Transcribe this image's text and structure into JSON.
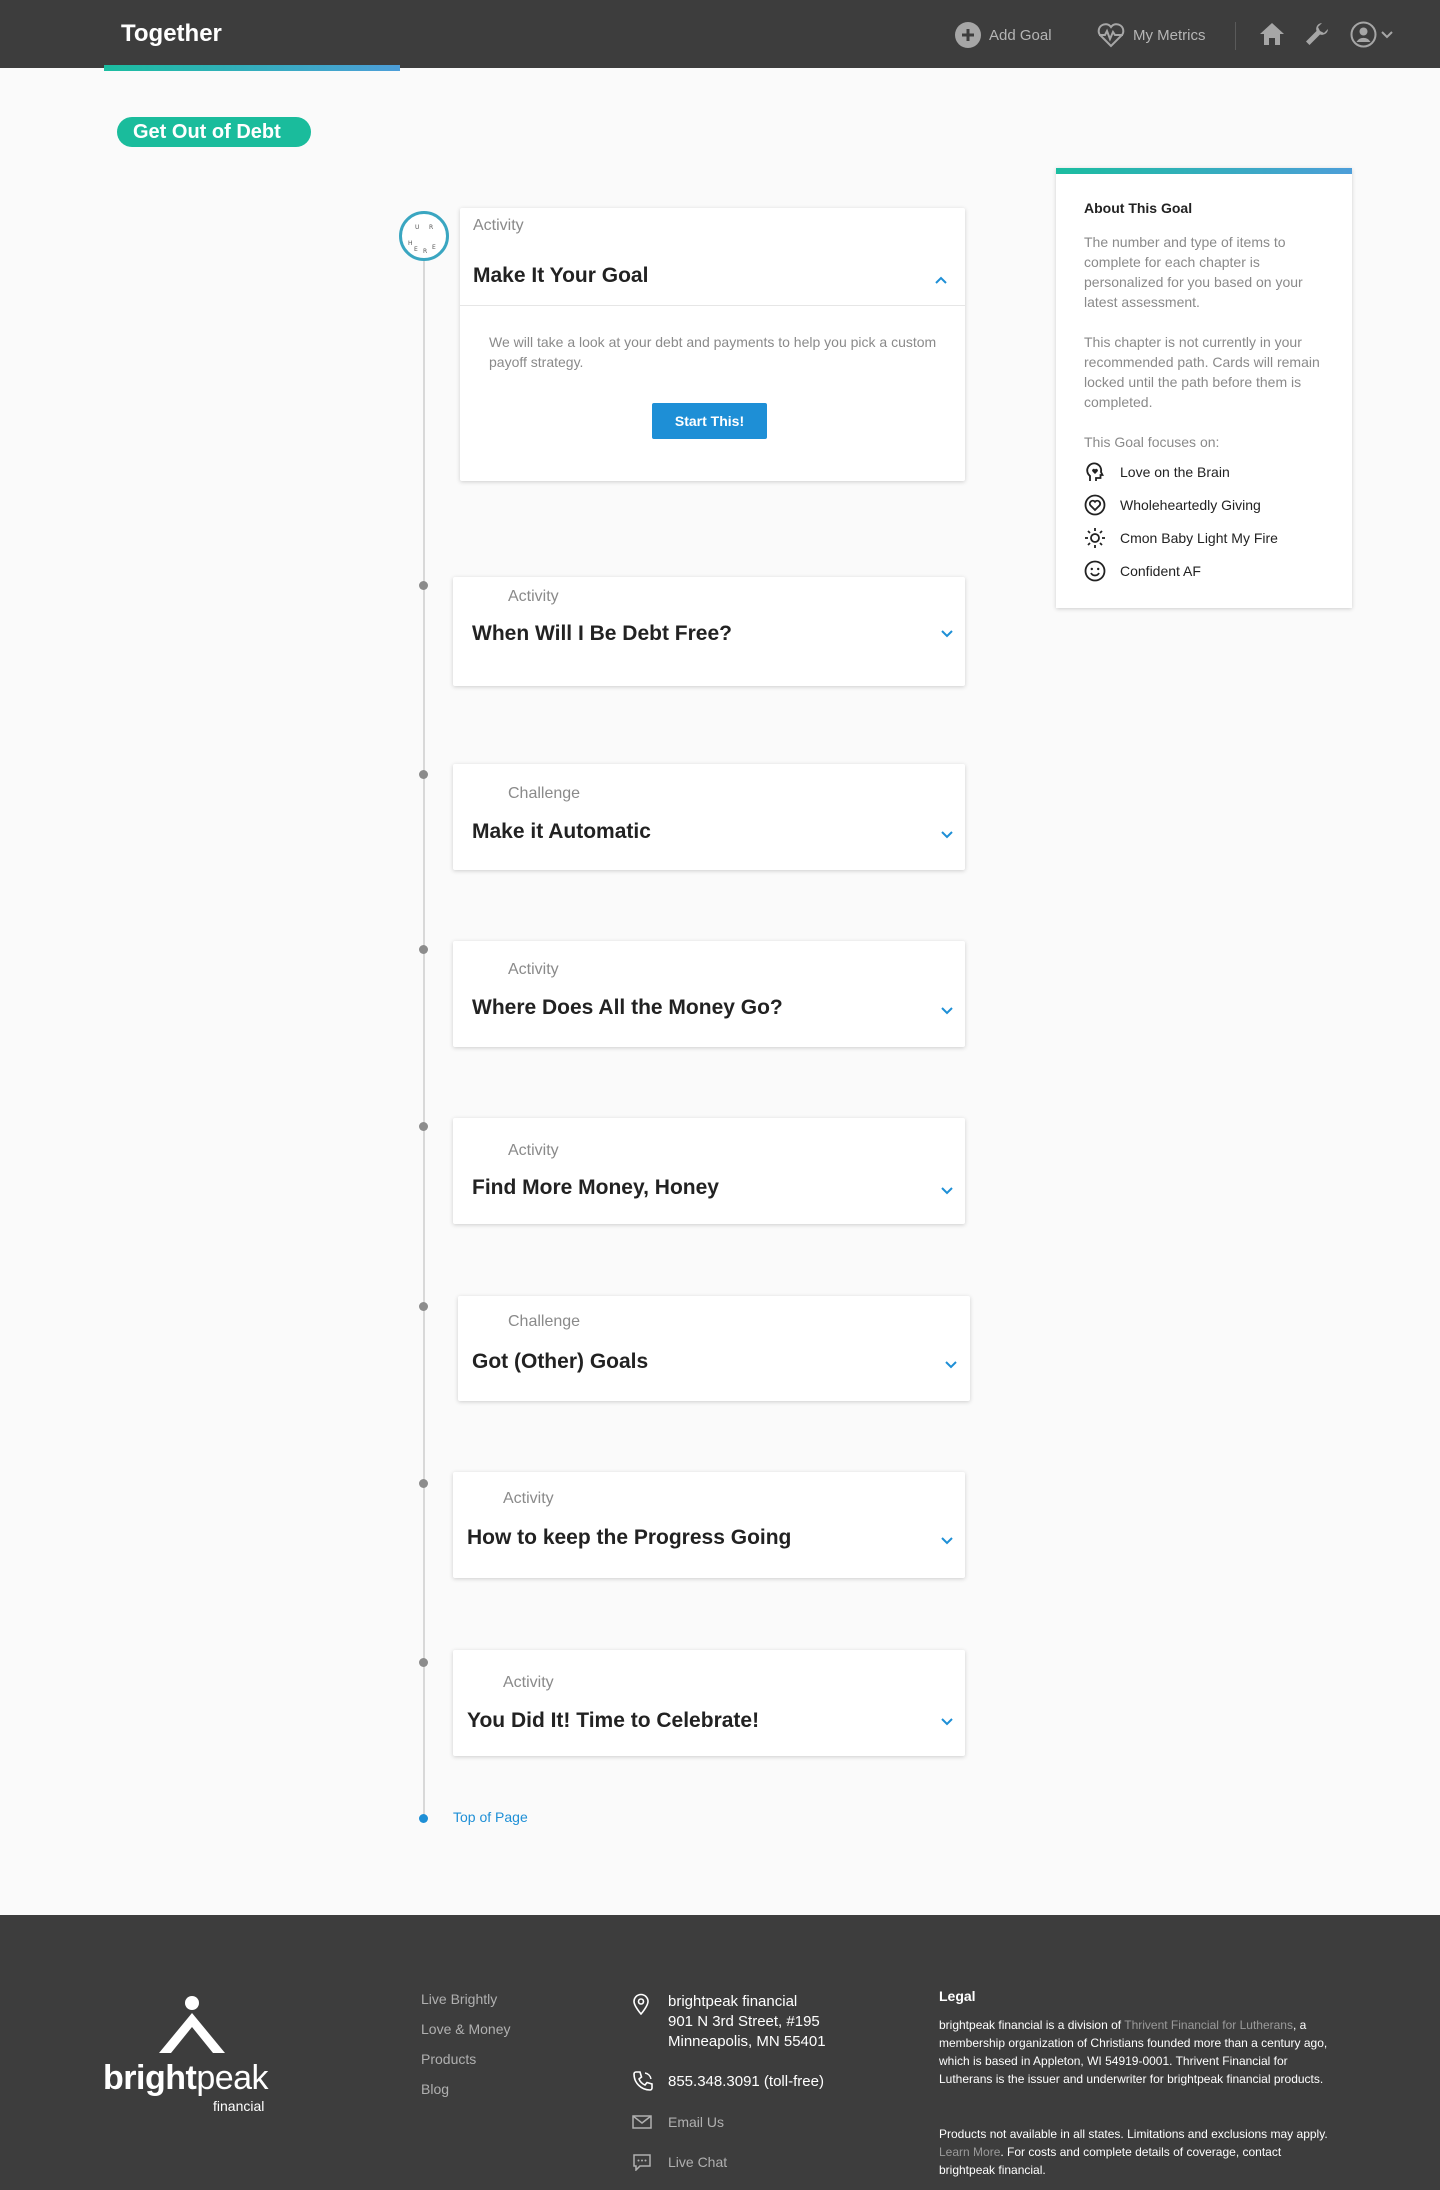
{
  "header": {
    "brand": "Together",
    "add_goal": "Add Goal",
    "my_metrics": "My Metrics"
  },
  "goal": {
    "title": "Get Out of Debt"
  },
  "badge": {
    "letters": [
      "U",
      "R",
      "H",
      "E",
      "R",
      "E"
    ]
  },
  "cards": [
    {
      "type": "Activity",
      "title": "Make It Your Goal",
      "expanded": true,
      "description": "We will take a look at your debt and payments to help you pick a custom payoff strategy.",
      "button": "Start This!"
    },
    {
      "type": "Activity",
      "title": "When Will I Be Debt Free?"
    },
    {
      "type": "Challenge",
      "title": "Make it Automatic"
    },
    {
      "type": "Activity",
      "title": "Where Does All the Money Go?"
    },
    {
      "type": "Activity",
      "title": "Find More Money, Honey"
    },
    {
      "type": "Challenge",
      "title": "Got (Other) Goals"
    },
    {
      "type": "Activity",
      "title": "How to keep the Progress Going"
    },
    {
      "type": "Activity",
      "title": "You Did It! Time to Celebrate!"
    }
  ],
  "top_link": "Top of Page",
  "about": {
    "title": "About This Goal",
    "p1": "The number and type of items to complete for each chapter is personalized for you based on your latest assessment.",
    "p2": "This chapter is not currently in your recommended path. Cards will remain locked until the path before them is completed.",
    "focus_label": "This Goal focuses on:",
    "focus": [
      {
        "label": "Love on the Brain",
        "icon": "brain-heart-icon"
      },
      {
        "label": "Wholeheartedly Giving",
        "icon": "heart-circle-icon"
      },
      {
        "label": "Cmon Baby Light My Fire",
        "icon": "sun-icon"
      },
      {
        "label": "Confident AF",
        "icon": "smile-icon"
      }
    ]
  },
  "footer": {
    "logo_bold": "bright",
    "logo_light": "peak",
    "logo_sub": "financial",
    "links": [
      "Live Brightly",
      "Love & Money",
      "Products",
      "Blog"
    ],
    "address": [
      "brightpeak financial",
      "901 N 3rd Street, #195",
      "Minneapolis, MN 55401"
    ],
    "phone": "855.348.3091 (toll-free)",
    "email": "Email Us",
    "chat": "Live Chat",
    "legal_title": "Legal",
    "legal1_a": "brightpeak financial is a division of ",
    "legal1_link": "Thrivent Financial for Lutherans",
    "legal1_b": ", a membership organization of Christians founded more than a century ago, which is based in Appleton, WI 54919-0001. Thrivent Financial for Lutherans is the issuer and underwriter for brightpeak financial products.",
    "legal2_a": "Products not available in all states. Limitations and exclusions may apply. ",
    "legal2_link": "Learn More",
    "legal2_b": ". For costs and complete details of coverage, contact brightpeak financial."
  },
  "colors": {
    "accent_teal": "#1abc9c",
    "accent_blue": "#1e8fd6",
    "header_bg": "#3d3d3d"
  }
}
